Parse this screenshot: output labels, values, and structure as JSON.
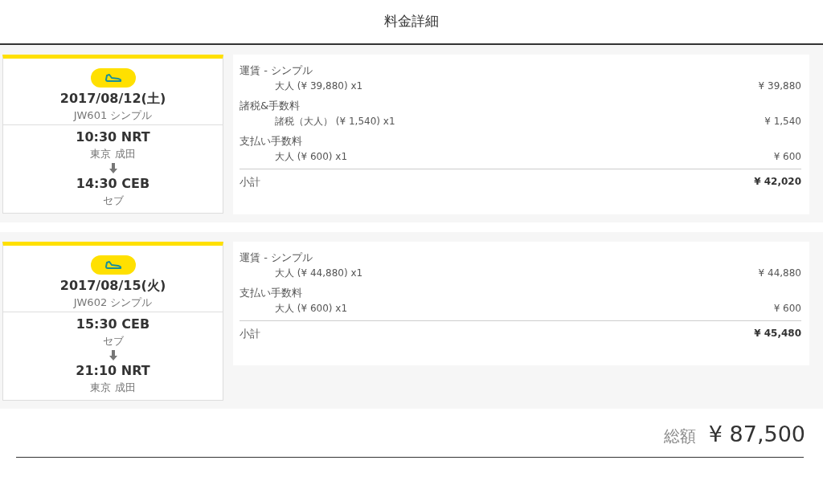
{
  "title": "料金詳細",
  "flights": [
    {
      "date": "2017/08/12(土)",
      "flight": "JW601 シンプル",
      "departure": {
        "time": "10:30 NRT",
        "city": "東京 成田"
      },
      "arrival": {
        "time": "14:30 CEB",
        "city": "セブ"
      },
      "charges": [
        {
          "label": "運賃 - シンプル",
          "items": [
            {
              "description": "大人 (¥ 39,880) x1",
              "amount": "¥ 39,880"
            }
          ]
        },
        {
          "label": "諸税&手数料",
          "items": [
            {
              "description": "諸税（大人） (¥ 1,540) x1",
              "amount": "¥ 1,540"
            }
          ]
        },
        {
          "label": "支払い手数料",
          "items": [
            {
              "description": "大人 (¥ 600) x1",
              "amount": "¥ 600"
            }
          ]
        }
      ],
      "subtotal_label": "小計",
      "subtotal": "¥ 42,020"
    },
    {
      "date": "2017/08/15(火)",
      "flight": "JW602 シンプル",
      "departure": {
        "time": "15:30 CEB",
        "city": "セブ"
      },
      "arrival": {
        "time": "21:10 NRT",
        "city": "東京 成田"
      },
      "charges": [
        {
          "label": "運賃 - シンプル",
          "items": [
            {
              "description": "大人 (¥ 44,880) x1",
              "amount": "¥ 44,880"
            }
          ]
        },
        {
          "label": "支払い手数料",
          "items": [
            {
              "description": "大人 (¥ 600) x1",
              "amount": "¥ 600"
            }
          ]
        }
      ],
      "subtotal_label": "小計",
      "subtotal": "¥ 45,480"
    }
  ],
  "total": {
    "label": "総額",
    "amount": "¥ 87,500"
  }
}
